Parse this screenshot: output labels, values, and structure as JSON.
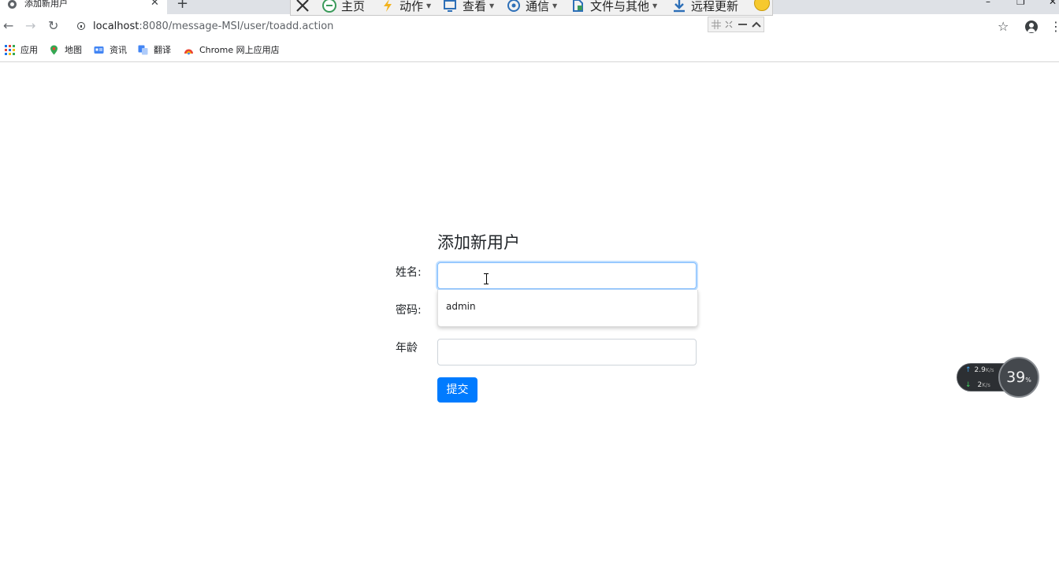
{
  "browser": {
    "tab_title": "添加新用户",
    "tab_close": "✕",
    "new_tab": "+",
    "url_host": "localhost",
    "url_path": ":8080/message-MSI/user/toadd.action",
    "window_controls": [
      "–",
      "❐",
      "✕"
    ]
  },
  "remote_toolbar": {
    "items": [
      {
        "label": "主页",
        "icon": "home-icon"
      },
      {
        "label": "动作",
        "icon": "lightning-icon",
        "has_dropdown": true
      },
      {
        "label": "查看",
        "icon": "monitor-icon",
        "has_dropdown": true
      },
      {
        "label": "通信",
        "icon": "chat-icon",
        "has_dropdown": true
      },
      {
        "label": "文件与其他",
        "icon": "file-transfer-icon",
        "has_dropdown": true
      },
      {
        "label": "远程更新",
        "icon": "download-icon"
      }
    ]
  },
  "bookmarks": [
    {
      "label": "应用",
      "icon": "apps-grid-icon"
    },
    {
      "label": "地图",
      "icon": "maps-icon"
    },
    {
      "label": "资讯",
      "icon": "news-icon"
    },
    {
      "label": "翻译",
      "icon": "translate-icon"
    },
    {
      "label": "Chrome 网上应用店",
      "icon": "chrome-webstore-icon"
    }
  ],
  "form": {
    "title": "添加新用户",
    "name_label": "姓名:",
    "password_label": "密码:",
    "age_label": "年龄",
    "name_value": "",
    "age_value": "",
    "autocomplete_suggestion": "admin",
    "submit_label": "提交"
  },
  "net_monitor": {
    "upload": "2.9",
    "upload_unit": "K/s",
    "download": "2",
    "download_unit": "K/s",
    "percent": "39",
    "percent_unit": "%"
  }
}
